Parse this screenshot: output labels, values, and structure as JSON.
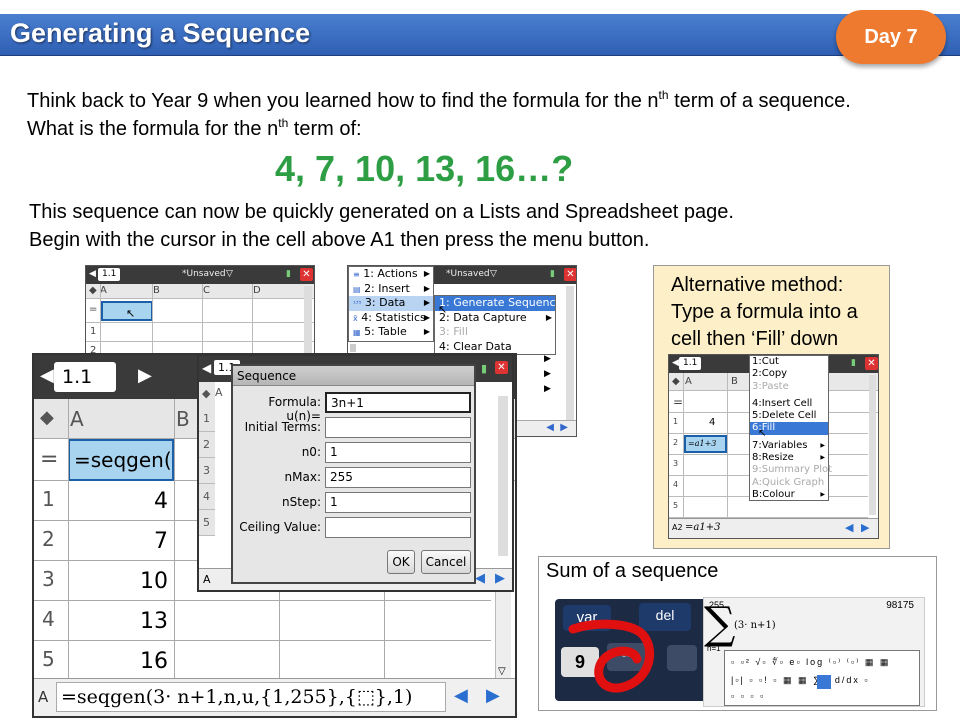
{
  "title": "Generating a Sequence",
  "day_badge": "Day 7",
  "intro": {
    "line1_pre": "Think back to Year 9 when you learned how to find the formula for the n",
    "line1_sup": "th",
    "line1_post": " term of a sequence.",
    "line2_pre": "What is the formula for the n",
    "line2_sup": "th",
    "line2_post": " term of:"
  },
  "sequence": "4, 7, 10, 13, 16…?",
  "instructions": {
    "line1": "This sequence can now be quickly generated on a Lists and Spreadsheet page.",
    "line2": "Begin with the cursor in the cell above A1 then press the menu button."
  },
  "screen1": {
    "tab": "1.1",
    "doc": "*Unsaved",
    "columns": [
      "A",
      "B",
      "C",
      "D"
    ],
    "rows": [
      "=",
      "1",
      "2"
    ]
  },
  "screen2": {
    "doc": "*Unsaved",
    "menu": [
      "1: Actions",
      "2: Insert",
      "3: Data",
      "4: Statistics",
      "5: Table"
    ],
    "menu_icons": [
      "≡",
      "▤",
      "¹³⁵",
      "x̄",
      "▦"
    ],
    "submenu": [
      "1: Generate Sequence",
      "2: Data Capture",
      "3: Fill",
      "4: Clear Data"
    ]
  },
  "big_screen": {
    "tab": "1.1",
    "col_a": "A",
    "col_b": "B",
    "formula_cell": "=seqgen(3",
    "rows": [
      "1",
      "2",
      "3",
      "4",
      "5"
    ],
    "values": [
      "4",
      "7",
      "10",
      "13",
      "16"
    ],
    "entry_label": "A",
    "entry_line": "=seqgen(3· n+1,n,u,{1,255},{⬚},1)"
  },
  "dialog": {
    "tab": "1.1",
    "title": "Sequence",
    "side_labels": [
      "A",
      "1",
      "2",
      "3",
      "4",
      "5",
      "A"
    ],
    "fields": [
      {
        "label": "Formula: u(n)=",
        "value": "3n+1"
      },
      {
        "label": "Initial Terms:",
        "value": ""
      },
      {
        "label": "n0:",
        "value": "1"
      },
      {
        "label": "nMax:",
        "value": "255"
      },
      {
        "label": "nStep:",
        "value": "1"
      },
      {
        "label": "Ceiling Value:",
        "value": ""
      }
    ],
    "ok": "OK",
    "cancel": "Cancel"
  },
  "alternative": {
    "text": "Alternative method: Type a formula into a cell then ‘Fill’ down",
    "tab": "1.1",
    "col_a": "A",
    "col_b": "B",
    "cell_a1": "4",
    "cell_a2": "=a1+3",
    "entry_label": "A2",
    "entry_value": "=a1+3",
    "rows": [
      "1",
      "2",
      "3",
      "4",
      "5"
    ],
    "menu": [
      "1:Cut",
      "2:Copy",
      "3:Paste",
      "4:Insert Cell",
      "5:Delete Cell",
      "6:Fill",
      "7:Variables",
      "8:Resize",
      "9:Summary Plot",
      "A:Quick Graph",
      "B:Colour"
    ]
  },
  "sum": {
    "title": "Sum of a sequence",
    "key_var": "var",
    "key_del": "del",
    "key_9": "9",
    "upper": "255",
    "result": "98175",
    "expr": "(3· n+1)",
    "lower": "n=1"
  },
  "colors": {
    "title_bar": "#3a6fc4",
    "badge": "#ee7a2f",
    "sequence": "#2e9e44",
    "selection": "#3a78d6",
    "alt_box": "#fdf0c8"
  }
}
